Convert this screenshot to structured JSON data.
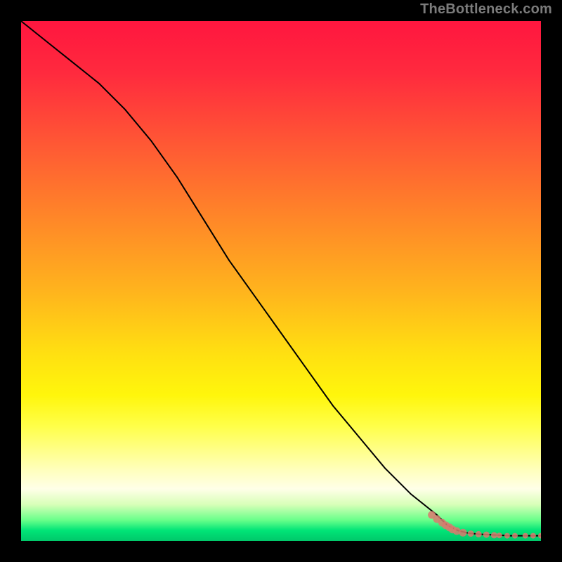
{
  "watermark": "TheBottleneck.com",
  "colors": {
    "frame": "#000000",
    "line": "#000000",
    "marker": "#d87a6e",
    "gradient_top": "#ff163f",
    "gradient_mid": "#ffe011",
    "gradient_bottom": "#00c86a"
  },
  "chart_data": {
    "type": "line",
    "title": "",
    "xlabel": "",
    "ylabel": "",
    "xlim": [
      0,
      100
    ],
    "ylim": [
      0,
      100
    ],
    "grid": false,
    "legend": false,
    "series": [
      {
        "name": "main-curve",
        "x": [
          0,
          5,
          10,
          15,
          20,
          25,
          30,
          35,
          40,
          45,
          50,
          55,
          60,
          65,
          70,
          75,
          80,
          82,
          84,
          86,
          88,
          90,
          92,
          94,
          96,
          98,
          100
        ],
        "y": [
          100,
          96,
          92,
          88,
          83,
          77,
          70,
          62,
          54,
          47,
          40,
          33,
          26,
          20,
          14,
          9,
          5,
          3,
          2,
          1.5,
          1.3,
          1.2,
          1.1,
          1.0,
          1.0,
          1.0,
          1.0
        ]
      }
    ],
    "scatter_tail": {
      "name": "bottom-markers",
      "x": [
        79,
        80,
        81,
        81.7,
        82.4,
        83,
        83.8,
        85,
        86.5,
        88,
        89.5,
        91,
        92,
        93.5,
        95,
        97,
        98.5,
        100
      ],
      "y": [
        5.0,
        4.2,
        3.5,
        3.0,
        2.6,
        2.2,
        1.9,
        1.6,
        1.4,
        1.3,
        1.2,
        1.1,
        1.05,
        1.0,
        1.0,
        1.0,
        1.0,
        1.0
      ]
    }
  }
}
